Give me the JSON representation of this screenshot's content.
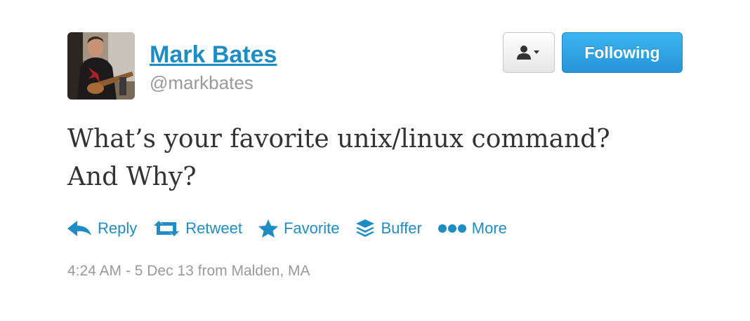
{
  "user": {
    "name": "Mark Bates",
    "handle": "@markbates",
    "avatar_icon": "user-avatar-photo"
  },
  "buttons": {
    "user_menu_icon": "person-dropdown-icon",
    "following_label": "Following"
  },
  "tweet": {
    "text_line1": "What’s your favorite unix/linux command?",
    "text_line2": "And Why?"
  },
  "actions": [
    {
      "label": "Reply",
      "icon": "reply-icon"
    },
    {
      "label": "Retweet",
      "icon": "retweet-icon"
    },
    {
      "label": "Favorite",
      "icon": "star-icon"
    },
    {
      "label": "Buffer",
      "icon": "buffer-icon"
    },
    {
      "label": "More",
      "icon": "more-dots-icon"
    }
  ],
  "meta": {
    "time": "4:24 AM",
    "separator": " - ",
    "date": "5 Dec 13",
    "location": " from Malden, MA"
  },
  "colors": {
    "link": "#1f8dc4",
    "following_button": "#2794d7",
    "muted": "#999999",
    "text": "#333333"
  }
}
